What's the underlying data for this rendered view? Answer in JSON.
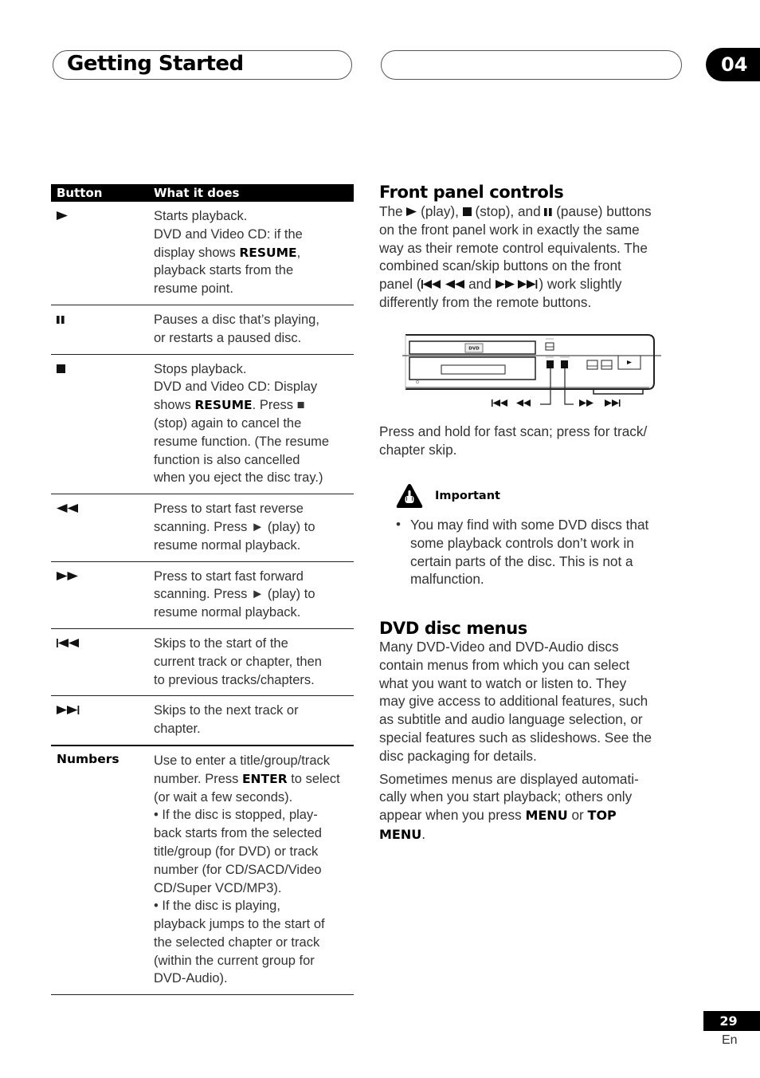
{
  "header": {
    "section_title": "Getting Started",
    "chapter_number": "04"
  },
  "table": {
    "columns": [
      "Button",
      "What it does"
    ],
    "rows": [
      {
        "button_icon": "play-icon",
        "lines": [
          "Starts playback.",
          "DVD and Video CD: if the",
          "display shows |RESUME|,",
          "playback starts from the",
          "resume point."
        ]
      },
      {
        "button_icon": "pause-icon",
        "lines": [
          "Pauses a disc that’s playing,",
          "or restarts a paused disc."
        ]
      },
      {
        "button_icon": "stop-icon",
        "lines": [
          "Stops playback.",
          "DVD and Video CD: Display",
          "shows |RESUME|. Press ■",
          "(stop) again to cancel the",
          "resume function. (The resume",
          "function is also cancelled",
          "when you eject the disc tray.)"
        ]
      },
      {
        "button_icon": "rewind-icon",
        "lines": [
          "Press to start fast reverse",
          "scanning. Press ► (play) to",
          "resume normal playback."
        ]
      },
      {
        "button_icon": "fast-forward-icon",
        "lines": [
          "Press to start fast forward",
          "scanning. Press ► (play) to",
          "resume normal playback."
        ]
      },
      {
        "button_icon": "skip-previous-icon",
        "lines": [
          "Skips to the start of the",
          "current track or chapter, then",
          "to previous tracks/chapters."
        ]
      },
      {
        "button_icon": "skip-next-icon",
        "lines": [
          "Skips to the next track or",
          "chapter."
        ]
      },
      {
        "button_label": "Numbers",
        "lines": [
          "Use to enter a title/group/track",
          "number. Press |ENTER| to select",
          "(or wait a few seconds).",
          "• If the disc is stopped, play-",
          "back starts from the selected",
          "title/group (for DVD) or track",
          "number (for CD/SACD/Video",
          "CD/Super VCD/MP3).",
          "• If the disc is playing,",
          "playback jumps to the start of",
          "the selected chapter or track",
          "(within the current group for",
          "DVD-Audio)."
        ]
      }
    ]
  },
  "front_panel": {
    "heading": "Front panel controls",
    "intro": {
      "t1": "The ",
      "t2": " (play), ",
      "t3": " (stop), and ",
      "t4": " (pause) buttons",
      "line2": "on the front panel work in exactly the same",
      "line3": "way as their remote control equivalents. The",
      "line4": "combined scan/skip buttons on the front",
      "t5": "panel (",
      "t6": " and ",
      "t7": ") work slightly",
      "line6": "differently from the remote buttons."
    },
    "diagram_logo": "DVD",
    "caption_line1": "Press and hold for fast scan; press for track/",
    "caption_line2": "chapter skip."
  },
  "important": {
    "label": "Important",
    "bullet_lines": [
      "You may find with some DVD discs that",
      "some playback controls don’t work in",
      "certain parts of the disc. This is not a",
      "malfunction."
    ]
  },
  "dvd_menus": {
    "heading": "DVD disc menus",
    "para1_lines": [
      "Many DVD-Video and DVD-Audio discs",
      "contain menus from which you can select",
      "what you want to watch or listen to. They",
      "may give access to additional features, such",
      "as subtitle and audio language selection, or",
      "special features such as slideshows. See the",
      "disc packaging for details."
    ],
    "para2_lines": [
      "Sometimes menus are displayed automati-",
      "cally when you start playback; others only",
      "appear when you press |MENU| or |TOP|",
      "|MENU|."
    ]
  },
  "footer": {
    "page_number": "29",
    "language": "En"
  }
}
